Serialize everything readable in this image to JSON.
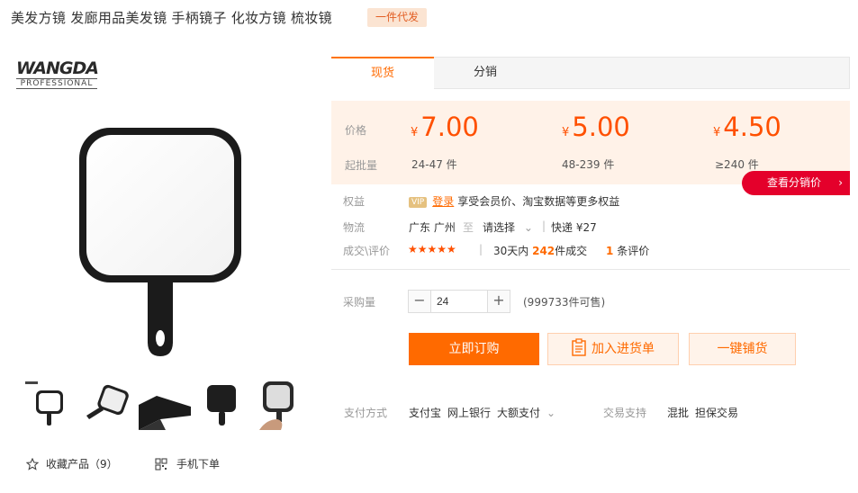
{
  "product": {
    "title": "美发方镜 发廊用品美发镜 手柄镜子 化妆方镜 梳妆镜",
    "tag": "一件代发"
  },
  "logo": {
    "brand_main": "WANGDA",
    "brand_sub": "PROFESSIONAL"
  },
  "tabs": [
    {
      "label": "现货",
      "active": true
    },
    {
      "label": "分销",
      "active": false
    }
  ],
  "pricing": {
    "price_label": "价格",
    "moq_label": "起批量",
    "currency": "¥",
    "tiers": [
      {
        "price": "7.00",
        "qty": "24-47 件"
      },
      {
        "price": "5.00",
        "qty": "48-239 件"
      },
      {
        "price": "4.50",
        "qty": "≥240 件"
      }
    ],
    "accent_color": "#ff5000"
  },
  "distribution_button": "查看分销价",
  "benefits": {
    "label": "权益",
    "vip_badge": "VIP",
    "login_link": "登录",
    "text": "享受会员价、淘宝数据等更多权益"
  },
  "logistics": {
    "label": "物流",
    "origin": "广东 广州",
    "to": "至",
    "destination": "请选择",
    "express": "快递 ¥27"
  },
  "deals": {
    "label": "成交\\评价",
    "rating_stars": 5,
    "prefix": "30天内",
    "count": "242",
    "suffix": "件成交",
    "review_count": "1",
    "review_suffix": "条评价"
  },
  "purchase": {
    "label": "采购量",
    "quantity": "24",
    "available": "(999733件可售)"
  },
  "buttons": {
    "buy": "立即订购",
    "cart": "加入进货单",
    "ship": "一键铺货"
  },
  "payment": {
    "label": "支付方式",
    "methods": [
      "支付宝",
      "网上银行",
      "大额支付"
    ]
  },
  "trade": {
    "label": "交易支持",
    "items": [
      "混批",
      "担保交易"
    ]
  },
  "footer": {
    "favorite": "收藏产品（9）",
    "mobile_order": "手机下单"
  }
}
